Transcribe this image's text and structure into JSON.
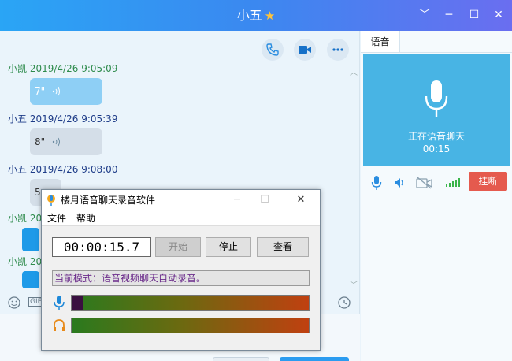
{
  "window": {
    "title": "小五",
    "controls": {
      "dropdown": "﹀",
      "minimize": "─",
      "maximize": "☐",
      "close": "✕"
    }
  },
  "chat": {
    "messages": [
      {
        "sender": "小凯",
        "time": "2019/4/26 9:05:09",
        "bubble_text": "7\""
      },
      {
        "sender": "小五",
        "time": "2019/4/26 9:05:39",
        "bubble_text": "8\""
      },
      {
        "sender": "小五",
        "time": "2019/4/26 9:08:00",
        "bubble_text": "5"
      },
      {
        "sender": "小凯",
        "time": "20"
      },
      {
        "sender": "小凯",
        "time": "20"
      }
    ]
  },
  "right_panel": {
    "tab_label": "语音",
    "status": "正在语音聊天",
    "timer": "00:15",
    "hangup_label": "挂断"
  },
  "recorder": {
    "title": "楼月语音聊天录音软件",
    "menu": [
      "文件",
      "帮助"
    ],
    "time_display": "00:00:15.7",
    "buttons": {
      "start": "开始",
      "stop": "停止",
      "view": "查看"
    },
    "mode_text": "当前模式：语音视频聊天自动录音。",
    "mic_level": 0.05,
    "speaker_level": 0.0,
    "gif_label": "GIF"
  },
  "colors": {
    "titlebar_start": "#2aa5f5",
    "titlebar_end": "#6a6ef0",
    "voice_panel": "#48b4e4",
    "hangup": "#e55a4e",
    "bubble_self": "#8ecff5",
    "bubble_other": "#d4dee8"
  }
}
